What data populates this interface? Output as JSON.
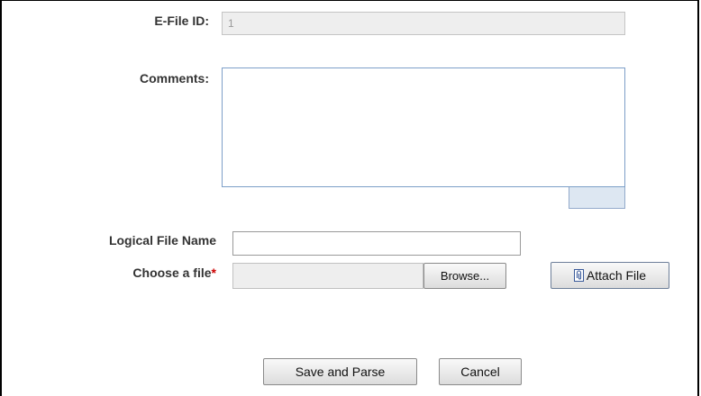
{
  "form": {
    "efile_label": "E-File ID:",
    "efile_value": "1",
    "comments_label": "Comments:",
    "comments_value": "",
    "logical_name_label": "Logical File Name",
    "logical_name_value": "",
    "choose_file_label": "Choose a file",
    "required_marker": "*",
    "file_path_value": ""
  },
  "buttons": {
    "browse": "Browse...",
    "attach": "Attach File",
    "save": "Save and Parse",
    "cancel": "Cancel"
  },
  "icons": {
    "attach": "paperclip-icon"
  },
  "colors": {
    "required": "#cc0000",
    "comments_border": "#7d9fc8"
  }
}
